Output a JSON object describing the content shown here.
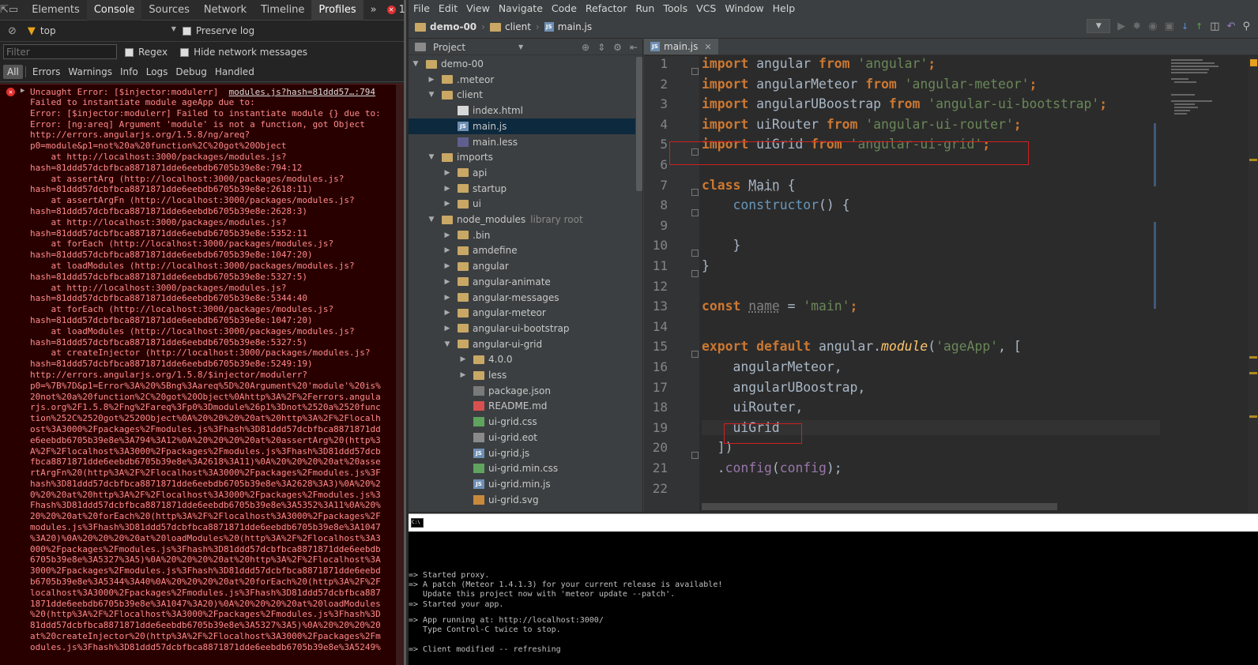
{
  "devtools": {
    "tabs": [
      "Elements",
      "Console",
      "Sources",
      "Network",
      "Timeline",
      "Profiles"
    ],
    "active_tab": "Console",
    "more_tabs": "»",
    "error_count": "1",
    "context": "top",
    "preserve_log": "Preserve log",
    "filter_placeholder": "Filter",
    "regex": "Regex",
    "hide_network": "Hide network messages",
    "levels": [
      "All",
      "Errors",
      "Warnings",
      "Info",
      "Logs",
      "Debug",
      "Handled"
    ],
    "error": {
      "head": "Uncaught Error: [$injector:modulerr]",
      "source": "modules.js?hash=81ddd57…:794",
      "lines": [
        "Failed to instantiate module ageApp due to:",
        "Error: [$injector:modulerr] Failed to instantiate module {} due to:",
        "Error: [ng:areq] Argument 'module' is not a function, got Object",
        "http://errors.angularjs.org/1.5.8/ng/areq?",
        "p0=module&p1=not%20a%20function%2C%20got%20Object",
        "    at http://localhost:3000/packages/modules.js?",
        "hash=81ddd57dcbfbca8871871dde6eebdb6705b39e8e:794:12",
        "    at assertArg (http://localhost:3000/packages/modules.js?",
        "hash=81ddd57dcbfbca8871871dde6eebdb6705b39e8e:2618:11)",
        "    at assertArgFn (http://localhost:3000/packages/modules.js?",
        "hash=81ddd57dcbfbca8871871dde6eebdb6705b39e8e:2628:3)",
        "    at http://localhost:3000/packages/modules.js?",
        "hash=81ddd57dcbfbca8871871dde6eebdb6705b39e8e:5352:11",
        "    at forEach (http://localhost:3000/packages/modules.js?",
        "hash=81ddd57dcbfbca8871871dde6eebdb6705b39e8e:1047:20)",
        "    at loadModules (http://localhost:3000/packages/modules.js?",
        "hash=81ddd57dcbfbca8871871dde6eebdb6705b39e8e:5327:5)",
        "    at http://localhost:3000/packages/modules.js?",
        "hash=81ddd57dcbfbca8871871dde6eebdb6705b39e8e:5344:40",
        "    at forEach (http://localhost:3000/packages/modules.js?",
        "hash=81ddd57dcbfbca8871871dde6eebdb6705b39e8e:1047:20)",
        "    at loadModules (http://localhost:3000/packages/modules.js?",
        "hash=81ddd57dcbfbca8871871dde6eebdb6705b39e8e:5327:5)",
        "    at createInjector (http://localhost:3000/packages/modules.js?",
        "hash=81ddd57dcbfbca8871871dde6eebdb6705b39e8e:5249:19)",
        "http://errors.angularjs.org/1.5.8/$injector/modulerr?",
        "p0=%7B%7D&p1=Error%3A%20%5Bng%3Aareq%5D%20Argument%20'module'%20is%",
        "20not%20a%20function%2C%20got%20Object%0Ahttp%3A%2F%2Ferrors.angula",
        "rjs.org%2F1.5.8%2Fng%2Fareq%3Fp0%3Dmodule%26p1%3Dnot%2520a%2520func",
        "tion%252C%2520got%2520Object%0A%20%20%20%20at%20http%3A%2F%2Flocalh",
        "ost%3A3000%2Fpackages%2Fmodules.js%3Fhash%3D81ddd57dcbfbca8871871dd",
        "e6eebdb6705b39e8e%3A794%3A12%0A%20%20%20%20at%20assertArg%20(http%3",
        "A%2F%2Flocalhost%3A3000%2Fpackages%2Fmodules.js%3Fhash%3D81ddd57dcb",
        "fbca8871871dde6eebdb6705b39e8e%3A2618%3A11)%0A%20%20%20%20at%20asse",
        "rtArgFn%20(http%3A%2F%2Flocalhost%3A3000%2Fpackages%2Fmodules.js%3F",
        "hash%3D81ddd57dcbfbca8871871dde6eebdb6705b39e8e%3A2628%3A3)%0A%20%2",
        "0%20%20at%20http%3A%2F%2Flocalhost%3A3000%2Fpackages%2Fmodules.js%3",
        "Fhash%3D81ddd57dcbfbca8871871dde6eebdb6705b39e8e%3A5352%3A11%0A%20%",
        "20%20%20at%20forEach%20(http%3A%2F%2Flocalhost%3A3000%2Fpackages%2F",
        "modules.js%3Fhash%3D81ddd57dcbfbca8871871dde6eebdb6705b39e8e%3A1047",
        "%3A20)%0A%20%20%20%20at%20loadModules%20(http%3A%2F%2Flocalhost%3A3",
        "000%2Fpackages%2Fmodules.js%3Fhash%3D81ddd57dcbfbca8871871dde6eebdb",
        "6705b39e8e%3A5327%3A5)%0A%20%20%20%20at%20http%3A%2F%2Flocalhost%3A",
        "3000%2Fpackages%2Fmodules.js%3Fhash%3D81ddd57dcbfbca8871871dde6eebd",
        "b6705b39e8e%3A5344%3A40%0A%20%20%20%20at%20forEach%20(http%3A%2F%2F",
        "localhost%3A3000%2Fpackages%2Fmodules.js%3Fhash%3D81ddd57dcbfbca887",
        "1871dde6eebdb6705b39e8e%3A1047%3A20)%0A%20%20%20%20at%20loadModules",
        "%20(http%3A%2F%2Flocalhost%3A3000%2Fpackages%2Fmodules.js%3Fhash%3D",
        "81ddd57dcbfbca8871871dde6eebdb6705b39e8e%3A5327%3A5)%0A%20%20%20%20",
        "at%20createInjector%20(http%3A%2F%2Flocalhost%3A3000%2Fpackages%2Fm",
        "odules.js%3Fhash%3D81ddd57dcbfbca8871871dde6eebdb6705b39e8e%3A5249%"
      ]
    }
  },
  "ide": {
    "menu": [
      "File",
      "Edit",
      "View",
      "Navigate",
      "Code",
      "Refactor",
      "Run",
      "Tools",
      "VCS",
      "Window",
      "Help"
    ],
    "breadcrumb": [
      "demo-00",
      "client",
      "main.js"
    ],
    "project_label": "Project",
    "tree": [
      {
        "label": "demo-00",
        "depth": 0,
        "type": "folder",
        "open": true
      },
      {
        "label": ".meteor",
        "depth": 1,
        "type": "folder",
        "open": false
      },
      {
        "label": "client",
        "depth": 1,
        "type": "folder",
        "open": true
      },
      {
        "label": "index.html",
        "depth": 2,
        "type": "html"
      },
      {
        "label": "main.js",
        "depth": 2,
        "type": "js",
        "selected": true
      },
      {
        "label": "main.less",
        "depth": 2,
        "type": "less"
      },
      {
        "label": "imports",
        "depth": 1,
        "type": "folder",
        "open": true
      },
      {
        "label": "api",
        "depth": 2,
        "type": "folder",
        "open": false
      },
      {
        "label": "startup",
        "depth": 2,
        "type": "folder",
        "open": false
      },
      {
        "label": "ui",
        "depth": 2,
        "type": "folder",
        "open": false
      },
      {
        "label": "node_modules",
        "depth": 1,
        "type": "folder",
        "open": true,
        "tag": "library root"
      },
      {
        "label": ".bin",
        "depth": 2,
        "type": "folder",
        "open": false
      },
      {
        "label": "amdefine",
        "depth": 2,
        "type": "folder",
        "open": false
      },
      {
        "label": "angular",
        "depth": 2,
        "type": "folder",
        "open": false
      },
      {
        "label": "angular-animate",
        "depth": 2,
        "type": "folder",
        "open": false
      },
      {
        "label": "angular-messages",
        "depth": 2,
        "type": "folder",
        "open": false
      },
      {
        "label": "angular-meteor",
        "depth": 2,
        "type": "folder",
        "open": false
      },
      {
        "label": "angular-ui-bootstrap",
        "depth": 2,
        "type": "folder",
        "open": false
      },
      {
        "label": "angular-ui-grid",
        "depth": 2,
        "type": "folder",
        "open": true
      },
      {
        "label": "4.0.0",
        "depth": 3,
        "type": "folder",
        "open": false
      },
      {
        "label": "less",
        "depth": 3,
        "type": "folder",
        "open": false
      },
      {
        "label": "package.json",
        "depth": 3,
        "type": "json"
      },
      {
        "label": "README.md",
        "depth": 3,
        "type": "md"
      },
      {
        "label": "ui-grid.css",
        "depth": 3,
        "type": "css"
      },
      {
        "label": "ui-grid.eot",
        "depth": 3,
        "type": "eot"
      },
      {
        "label": "ui-grid.js",
        "depth": 3,
        "type": "js"
      },
      {
        "label": "ui-grid.min.css",
        "depth": 3,
        "type": "css"
      },
      {
        "label": "ui-grid.min.js",
        "depth": 3,
        "type": "js"
      },
      {
        "label": "ui-grid.svg",
        "depth": 3,
        "type": "svg"
      }
    ],
    "editor_tab": "main.js",
    "line_numbers": [
      "1",
      "2",
      "3",
      "4",
      "5",
      "6",
      "7",
      "8",
      "9",
      "10",
      "11",
      "12",
      "13",
      "14",
      "15",
      "16",
      "17",
      "18",
      "19",
      "20",
      "21",
      "22"
    ],
    "code": {
      "l1": [
        "import",
        " angular ",
        "from",
        " 'angular'",
        ";"
      ],
      "l2": [
        "import",
        " angularMeteor ",
        "from",
        " 'angular-meteor'",
        ";"
      ],
      "l3": [
        "import",
        " angularUBoostrap ",
        "from",
        " 'angular-ui-bootstrap'",
        ";"
      ],
      "l4": [
        "import",
        " uiRouter ",
        "from",
        " 'angular-ui-router'",
        ";"
      ],
      "l5": [
        "import",
        " uiGrid ",
        "from",
        " 'angular-ui-grid'",
        ";"
      ],
      "l7": [
        "class",
        " ",
        "Main",
        " {"
      ],
      "l8": [
        "    ",
        "constructor",
        "() {"
      ],
      "l10": "    }",
      "l11": "}",
      "l13": [
        "const",
        " ",
        "name",
        " = ",
        "'main'",
        ";"
      ],
      "l15": [
        "export default",
        " angular.",
        "module",
        "(",
        "'ageApp'",
        ", ["
      ],
      "l16": "    angularMeteor,",
      "l17": "    angularUBoostrap,",
      "l18": "    uiRouter,",
      "l19": "    uiGrid",
      "l20": "  ])",
      "l21": [
        "  .",
        "config",
        "(",
        "config",
        ");"
      ]
    }
  },
  "terminal": {
    "lines": [
      "=> Started proxy.",
      "=> A patch (Meteor 1.4.1.3) for your current release is available!",
      "   Update this project now with 'meteor update --patch'.",
      "=> Started your app.",
      "",
      "=> App running at: http://localhost:3000/",
      "   Type Control-C twice to stop.",
      "",
      "=> Client modified -- refreshing"
    ]
  }
}
